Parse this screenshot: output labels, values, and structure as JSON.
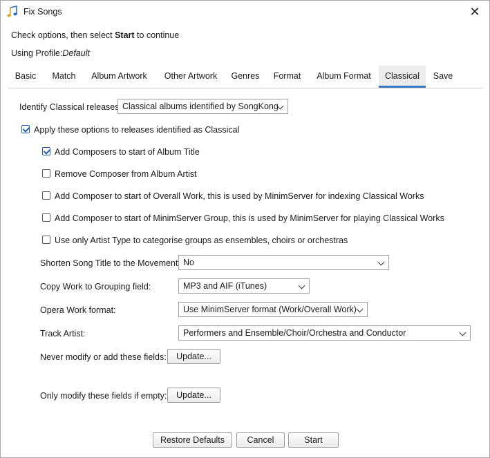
{
  "window": {
    "title": "Fix Songs",
    "close_icon": "close-icon"
  },
  "header": {
    "instruction_prefix": "Check options, then select ",
    "instruction_bold": "Start",
    "instruction_suffix": " to continue",
    "profile_label": "Using Profile:",
    "profile_value": "Default"
  },
  "tabs": [
    {
      "label": "Basic"
    },
    {
      "label": "Match"
    },
    {
      "label": "Album Artwork"
    },
    {
      "label": "Other Artwork"
    },
    {
      "label": "Genres"
    },
    {
      "label": "Format"
    },
    {
      "label": "Album Format"
    },
    {
      "label": "Classical"
    },
    {
      "label": "Save"
    }
  ],
  "active_tab": "Classical",
  "accent_color": "#3c78c3",
  "classical": {
    "identify_label": "Identify Classical releases:",
    "identify_value": "Classical albums identified by SongKong",
    "apply_label": "Apply these options to releases identified as Classical",
    "apply_checked": true,
    "options": [
      {
        "label": "Add Composers to start of Album Title",
        "checked": true
      },
      {
        "label": "Remove Composer from Album Artist",
        "checked": false
      },
      {
        "label": "Add Composer to start of Overall Work, this is used by MinimServer for indexing Classical Works",
        "checked": false
      },
      {
        "label": "Add Composer to start of MinimServer Group, this is used by MinimServer for playing Classical Works",
        "checked": false
      },
      {
        "label": "Use only Artist Type to categorise groups as ensembles, choirs or orchestras",
        "checked": false
      }
    ],
    "shorten_label": "Shorten Song Title to the Movement:",
    "shorten_value": "No",
    "copy_work_label": "Copy Work to Grouping field:",
    "copy_work_value": "MP3 and AIF (iTunes)",
    "opera_label": "Opera Work format:",
    "opera_value": "Use MinimServer format (Work/Overall Work)",
    "track_artist_label": "Track Artist:",
    "track_artist_value": "Performers and Ensemble/Choir/Orchestra and Conductor",
    "never_modify_label": "Never modify or add these fields:",
    "only_modify_label": "Only modify these fields if empty:",
    "update_button": "Update..."
  },
  "footer": {
    "restore": "Restore Defaults",
    "cancel": "Cancel",
    "start": "Start"
  }
}
